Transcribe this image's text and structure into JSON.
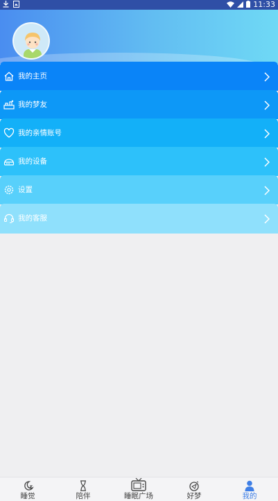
{
  "status_bar": {
    "time": "11:33",
    "icons": [
      "download-icon",
      "image-icon",
      "wifi-icon",
      "signal-icon",
      "battery-icon"
    ]
  },
  "profile": {
    "avatar_icon": "child-avatar-icon"
  },
  "menu": {
    "items": [
      {
        "label": "我的主页",
        "icon": "home-icon",
        "color": "#0a84f8"
      },
      {
        "label": "我的梦友",
        "icon": "friends-icon",
        "color": "#0d98f7"
      },
      {
        "label": "我的亲情账号",
        "icon": "heart-icon",
        "color": "#13b0f8"
      },
      {
        "label": "我的设备",
        "icon": "device-icon",
        "color": "#2dc1fa"
      },
      {
        "label": "设置",
        "icon": "gear-icon",
        "color": "#58d0fb"
      },
      {
        "label": "我的客服",
        "icon": "headset-icon",
        "color": "#8fe0fc"
      }
    ]
  },
  "tab_bar": {
    "tabs": [
      {
        "label": "睡觉",
        "icon": "moon-icon",
        "active": false
      },
      {
        "label": "陪伴",
        "icon": "hourglass-icon",
        "active": false
      },
      {
        "label": "睡眠广场",
        "icon": "tv-icon",
        "active": false
      },
      {
        "label": "好梦",
        "icon": "dream-icon",
        "active": false
      },
      {
        "label": "我的",
        "icon": "person-icon",
        "active": true
      }
    ]
  },
  "colors": {
    "accent": "#3f7fe6",
    "status_bar": "#2f4fa6"
  }
}
